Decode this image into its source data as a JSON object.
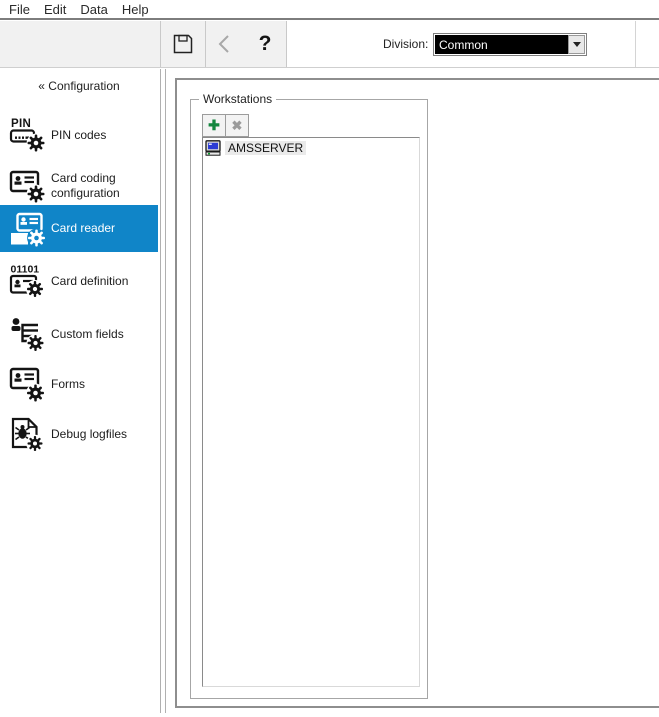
{
  "menu": {
    "items": [
      "File",
      "Edit",
      "Data",
      "Help"
    ]
  },
  "toolbar": {
    "help_label": "?",
    "division_label": "Division:",
    "division_value": "Common"
  },
  "icons": {
    "save": "floppy-disk",
    "back": "chevron-left",
    "help": "question-mark",
    "workstation": "computer-monitor",
    "gear": "gear",
    "add": "heavy-plus",
    "delete": "heavy-x"
  },
  "sidebar": {
    "header": "« Configuration",
    "pin_icon_text": "PIN",
    "card_definition_icon_text": "01101",
    "items": [
      {
        "label": "PIN codes",
        "selected": false
      },
      {
        "label": "Card coding configuration",
        "selected": false
      },
      {
        "label": "Card reader",
        "selected": true
      },
      {
        "label": "Card definition",
        "selected": false
      },
      {
        "label": "Custom fields",
        "selected": false
      },
      {
        "label": "Forms",
        "selected": false
      },
      {
        "label": "Debug logfiles",
        "selected": false
      }
    ]
  },
  "main": {
    "group_title": "Workstations",
    "add_button": "✚",
    "delete_button": "✖",
    "workstations": [
      {
        "name": "AMSSERVER"
      }
    ]
  },
  "colors": {
    "selected_blue": "#1085C8",
    "add_green": "#13863E",
    "dropdown_bg": "#000000",
    "dropdown_text": "#FFFFFF"
  }
}
